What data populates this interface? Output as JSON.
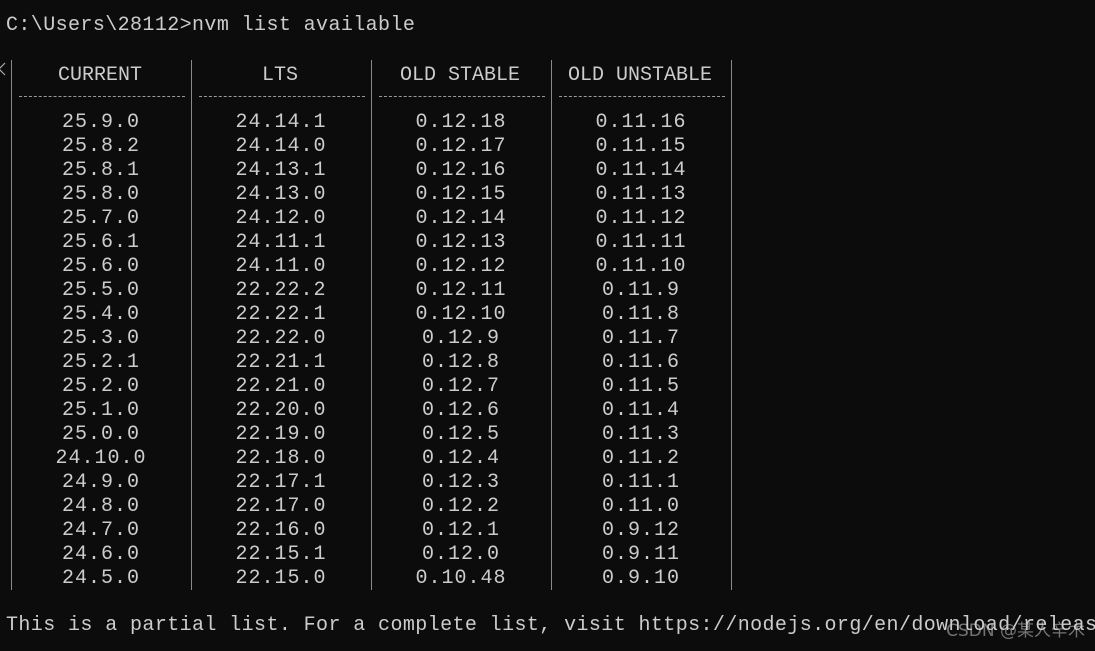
{
  "terminal": {
    "prompt_line": "C:\\Users\\28112>nvm list available",
    "footer_line": "This is a partial list. For a complete list, visit https://nodejs.org/en/download/releases"
  },
  "table": {
    "headers": [
      "CURRENT",
      "LTS",
      "OLD STABLE",
      "OLD UNSTABLE"
    ],
    "columns": [
      [
        "25.9.0",
        "25.8.2",
        "25.8.1",
        "25.8.0",
        "25.7.0",
        "25.6.1",
        "25.6.0",
        "25.5.0",
        "25.4.0",
        "25.3.0",
        "25.2.1",
        "25.2.0",
        "25.1.0",
        "25.0.0",
        "24.10.0",
        "24.9.0",
        "24.8.0",
        "24.7.0",
        "24.6.0",
        "24.5.0"
      ],
      [
        "24.14.1",
        "24.14.0",
        "24.13.1",
        "24.13.0",
        "24.12.0",
        "24.11.1",
        "24.11.0",
        "22.22.2",
        "22.22.1",
        "22.22.0",
        "22.21.1",
        "22.21.0",
        "22.20.0",
        "22.19.0",
        "22.18.0",
        "22.17.1",
        "22.17.0",
        "22.16.0",
        "22.15.1",
        "22.15.0"
      ],
      [
        "0.12.18",
        "0.12.17",
        "0.12.16",
        "0.12.15",
        "0.12.14",
        "0.12.13",
        "0.12.12",
        "0.12.11",
        "0.12.10",
        "0.12.9",
        "0.12.8",
        "0.12.7",
        "0.12.6",
        "0.12.5",
        "0.12.4",
        "0.12.3",
        "0.12.2",
        "0.12.1",
        "0.12.0",
        "0.10.48"
      ],
      [
        "0.11.16",
        "0.11.15",
        "0.11.14",
        "0.11.13",
        "0.11.12",
        "0.11.11",
        "0.11.10",
        "0.11.9",
        "0.11.8",
        "0.11.7",
        "0.11.6",
        "0.11.5",
        "0.11.4",
        "0.11.3",
        "0.11.2",
        "0.11.1",
        "0.11.0",
        "0.9.12",
        "0.9.11",
        "0.9.10"
      ]
    ]
  },
  "watermark": "CSDN @某人辛木",
  "colors": {
    "background": "#0c0c0c",
    "text": "#cccccc"
  }
}
